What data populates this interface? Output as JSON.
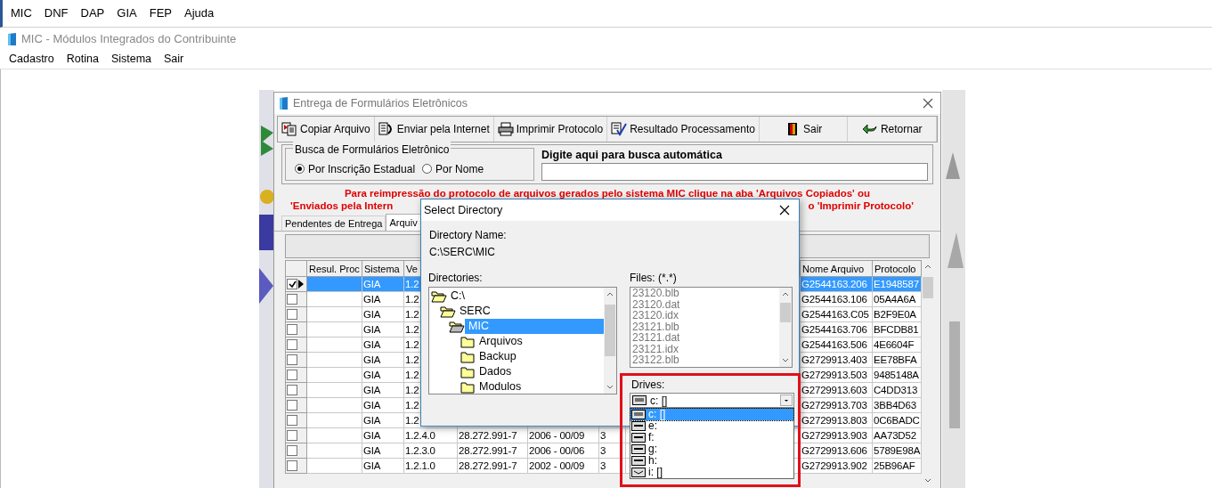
{
  "app_menu": [
    "MIC",
    "DNF",
    "DAP",
    "GIA",
    "FEP",
    "Ajuda"
  ],
  "window": {
    "title": "MIC - Módulos Integrados do Contribuinte"
  },
  "main_menu": [
    "Cadastro",
    "Rotina",
    "Sistema",
    "Sair"
  ],
  "form": {
    "title": "Entrega de Formulários Eletrônicos",
    "toolbar": [
      {
        "kind": "copy",
        "label": "Copiar Arquivo"
      },
      {
        "kind": "send",
        "label": "Enviar pela Internet"
      },
      {
        "kind": "print",
        "label": "Imprimir Protocolo"
      },
      {
        "kind": "result",
        "label": "Resultado Processamento"
      },
      {
        "kind": "exit",
        "label": "Sair"
      },
      {
        "kind": "back",
        "label": "Retornar"
      }
    ],
    "search_group": {
      "legend": "Busca de Formulários Eletrônico",
      "radios": [
        {
          "label": "Por Inscrição Estadual",
          "selected": true
        },
        {
          "label": "Por Nome",
          "selected": false
        }
      ]
    },
    "auto_search": {
      "label": "Digite aqui para busca automática"
    },
    "notice": {
      "line_1": "Para reimpressão do protocolo de arquivos gerados pelo sistema MIC clique na aba 'Arquivos Copiados' ou",
      "line_2_start": "'Enviados pela Intern",
      "line_2_end": "o 'Imprimir Protocolo'"
    },
    "tabs": [
      {
        "label": "Pendentes de Entrega",
        "selected": false
      },
      {
        "label": "Arquiv",
        "selected": true
      }
    ],
    "table": {
      "columns": {
        "resul_proc": "Resul. Proc",
        "sistema": "Sistema",
        "versao": "Ve",
        "nome_arquivo": "Nome Arquivo",
        "protocolo": "Protocolo"
      },
      "rows": [
        {
          "checked": true,
          "selected": true,
          "sistema": "GIA",
          "versao": "1.2",
          "nome_arquivo": "G2544163.206",
          "protocolo": "E1948587"
        },
        {
          "checked": false,
          "selected": false,
          "sistema": "GIA",
          "versao": "1.2",
          "nome_arquivo": "G2544163.106",
          "protocolo": "05A4A6A"
        },
        {
          "checked": false,
          "selected": false,
          "sistema": "GIA",
          "versao": "1.2",
          "nome_arquivo": "G2544163.C05",
          "protocolo": "B2F9E0A"
        },
        {
          "checked": false,
          "selected": false,
          "sistema": "GIA",
          "versao": "1.2",
          "nome_arquivo": "G2544163.706",
          "protocolo": "BFCDB81"
        },
        {
          "checked": false,
          "selected": false,
          "sistema": "GIA",
          "versao": "1.2",
          "nome_arquivo": "G2544163.506",
          "protocolo": "4E6604F"
        },
        {
          "checked": false,
          "selected": false,
          "sistema": "GIA",
          "versao": "1.2",
          "nome_arquivo": "G2729913.403",
          "protocolo": "EE78BFA"
        },
        {
          "checked": false,
          "selected": false,
          "sistema": "GIA",
          "versao": "1.2",
          "nome_arquivo": "G2729913.503",
          "protocolo": "9485148A"
        },
        {
          "checked": false,
          "selected": false,
          "sistema": "GIA",
          "versao": "1.2",
          "nome_arquivo": "G2729913.603",
          "protocolo": "C4DD313"
        },
        {
          "checked": false,
          "selected": false,
          "sistema": "GIA",
          "versao": "1.2",
          "nome_arquivo": "G2729913.703",
          "protocolo": "3BB4D63"
        },
        {
          "checked": false,
          "selected": false,
          "sistema": "GIA",
          "versao": "1.2",
          "nome_arquivo": "G2729913.803",
          "protocolo": "0C6BADC"
        },
        {
          "checked": false,
          "selected": false,
          "sistema": "GIA",
          "versao": "1.2.4.0",
          "inscricao": "28.272.991-7",
          "referencia": "2006 - 00/09",
          "column_7": "3",
          "nome_arquivo": "G2729913.903",
          "protocolo": "AA73D52"
        },
        {
          "checked": false,
          "selected": false,
          "sistema": "GIA",
          "versao": "1.2.3.0",
          "inscricao": "28.272.991-7",
          "referencia": "2006 - 00/06",
          "column_7": "3",
          "nome_arquivo": "G2729913.606",
          "protocolo": "5789E98A"
        },
        {
          "checked": false,
          "selected": false,
          "sistema": "GIA",
          "versao": "1.2.1.0",
          "inscricao": "28.272.991-7",
          "referencia": "2002 - 00/09",
          "column_7": "3",
          "nome_arquivo": "G2729913.902",
          "protocolo": "25B96AF"
        }
      ]
    }
  },
  "dialog": {
    "title": "Select Directory",
    "directory_name_label": "Directory Name:",
    "directory_name": "C:\\SERC\\MIC",
    "directories_label": "Directories:",
    "tree": [
      {
        "label": "C:\\",
        "expanded": true,
        "selected": false,
        "children": [
          {
            "label": "SERC",
            "expanded": true,
            "selected": false,
            "children": [
              {
                "label": "MIC",
                "expanded": true,
                "selected": true,
                "children": [
                  {
                    "label": "Arquivos",
                    "expanded": false,
                    "selected": false
                  },
                  {
                    "label": "Backup",
                    "expanded": false,
                    "selected": false
                  },
                  {
                    "label": "Dados",
                    "expanded": false,
                    "selected": false
                  },
                  {
                    "label": "Modulos",
                    "expanded": false,
                    "selected": false
                  }
                ]
              }
            ]
          }
        ]
      }
    ],
    "files_label": "Files: (*.*)",
    "files": [
      "23120.blb",
      "23120.dat",
      "23120.idx",
      "23121.blb",
      "23121.dat",
      "23121.idx",
      "23122.blb"
    ],
    "drives_label": "Drives:",
    "drive_value": "c: []",
    "drives": [
      {
        "label": "c: []",
        "kind": "fixed",
        "selected": true
      },
      {
        "label": "e:",
        "kind": "removable",
        "selected": false
      },
      {
        "label": "f:",
        "kind": "removable",
        "selected": false
      },
      {
        "label": "g:",
        "kind": "removable",
        "selected": false
      },
      {
        "label": "h:",
        "kind": "removable",
        "selected": false
      },
      {
        "label": "i: []",
        "kind": "optical",
        "selected": false
      }
    ]
  }
}
